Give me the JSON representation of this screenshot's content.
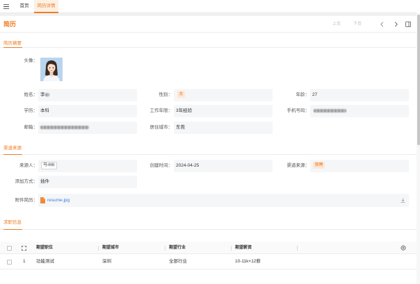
{
  "tabs": [
    {
      "label": "首页",
      "active": false
    },
    {
      "label": "简历详情",
      "active": true
    }
  ],
  "page": {
    "title": "简历",
    "prev_label": "上页",
    "next_label": "下页"
  },
  "summary": {
    "title": "简历摘要",
    "avatar_label": "头像：",
    "fields": {
      "name": {
        "label": "姓名：",
        "value": "李"
      },
      "gender": {
        "label": "性别：",
        "value": "女"
      },
      "age": {
        "label": "年龄：",
        "value": "27"
      },
      "education": {
        "label": "学历：",
        "value": "本科"
      },
      "experience": {
        "label": "工作年限：",
        "value": "3年经验"
      },
      "phone": {
        "label": "手机号码："
      },
      "email": {
        "label": "邮箱："
      },
      "city": {
        "label": "居住城市：",
        "value": "东莞"
      }
    }
  },
  "channel": {
    "title": "渠道来源",
    "fields": {
      "source_person": {
        "label": "来源人：",
        "value": "马"
      },
      "created_time": {
        "label": "创建时间：",
        "value": "2024-04-25"
      },
      "channel_source": {
        "label": "渠道来源：",
        "value": "猎聘"
      },
      "add_method": {
        "label": "添加方式：",
        "value": "插件"
      },
      "attachment": {
        "label": "附件简历：",
        "file_name": "resume.jpg"
      }
    }
  },
  "job": {
    "title": "求职信息",
    "table": {
      "columns": [
        "期望职位",
        "期望城市",
        "期望行业",
        "期望薪资"
      ],
      "rows": [
        {
          "index": "1",
          "cells": [
            "功能测试",
            "深圳",
            "全部行业",
            "10-11k×12薪"
          ]
        }
      ]
    }
  },
  "colors": {
    "accent": "#ef7d22",
    "accent_light": "#fdf0e5",
    "badge_bg": "#fde8d8",
    "link": "#3b7ddd",
    "field_bg": "#f5f6f8",
    "divider": "#ececec"
  },
  "icons": [
    "menu-icon",
    "chevron-left-icon",
    "chevron-right-icon",
    "layout-icon",
    "file-icon",
    "download-icon",
    "checkbox-icon",
    "expand-icon",
    "settings-icon"
  ]
}
